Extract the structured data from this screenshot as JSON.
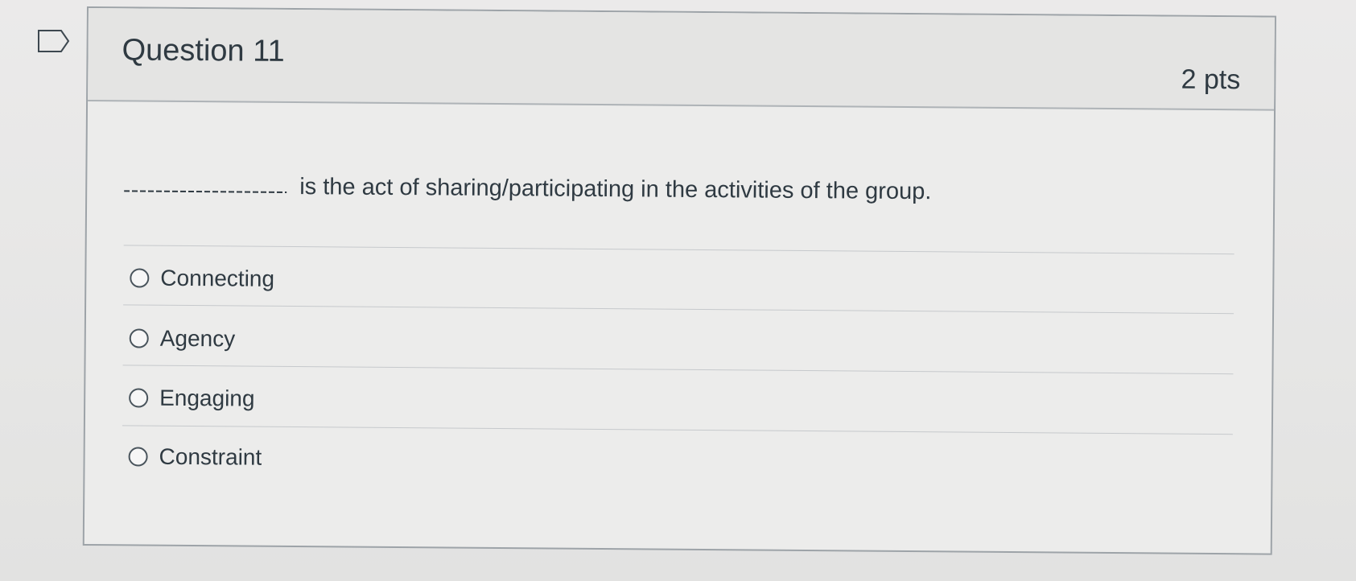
{
  "question": {
    "title": "Question 11",
    "points": "2 pts",
    "prompt": "is the act of sharing/participating in the activities of the group.",
    "answers": [
      "Connecting",
      "Agency",
      "Engaging",
      "Constraint"
    ]
  },
  "icons": {
    "flag": "bookmark-flag-icon",
    "radio": "radio-button-icon"
  },
  "colors": {
    "page_background": "#e6e6e5",
    "card_background": "#ececeb",
    "border": "#9da3a8",
    "text": "#2f3a42"
  }
}
